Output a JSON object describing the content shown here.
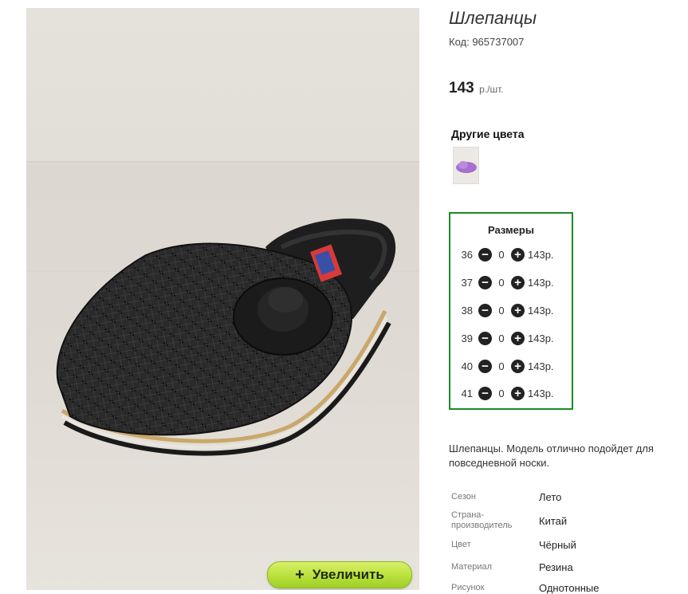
{
  "product": {
    "title": "Шлепанцы",
    "code": "Код: 965737007",
    "price": "143",
    "price_unit": "р./шт.",
    "zoom_label": "Увеличить",
    "zoom_icon": "plus-icon"
  },
  "other_colors": {
    "heading": "Другие цвета",
    "thumb_color": "#a66fd0"
  },
  "sizes": {
    "title": "Размеры",
    "accent": "#1c8a2a",
    "rows": [
      {
        "size": "36",
        "qty": "0",
        "price": "143р."
      },
      {
        "size": "37",
        "qty": "0",
        "price": "143р."
      },
      {
        "size": "38",
        "qty": "0",
        "price": "143р."
      },
      {
        "size": "39",
        "qty": "0",
        "price": "143р."
      },
      {
        "size": "40",
        "qty": "0",
        "price": "143р."
      },
      {
        "size": "41",
        "qty": "0",
        "price": "143р."
      }
    ]
  },
  "description": "Шлепанцы. Модель отлично подойдет для повседневной носки.",
  "properties": [
    {
      "label": "Сезон",
      "value": "Лето"
    },
    {
      "label": "Страна-\nпроизводитель",
      "value": "Китай"
    },
    {
      "label": "Цвет",
      "value": "Чёрный"
    },
    {
      "label": "Материал",
      "value": "Резина"
    },
    {
      "label": "Рисунок",
      "value": "Однотонные"
    }
  ]
}
